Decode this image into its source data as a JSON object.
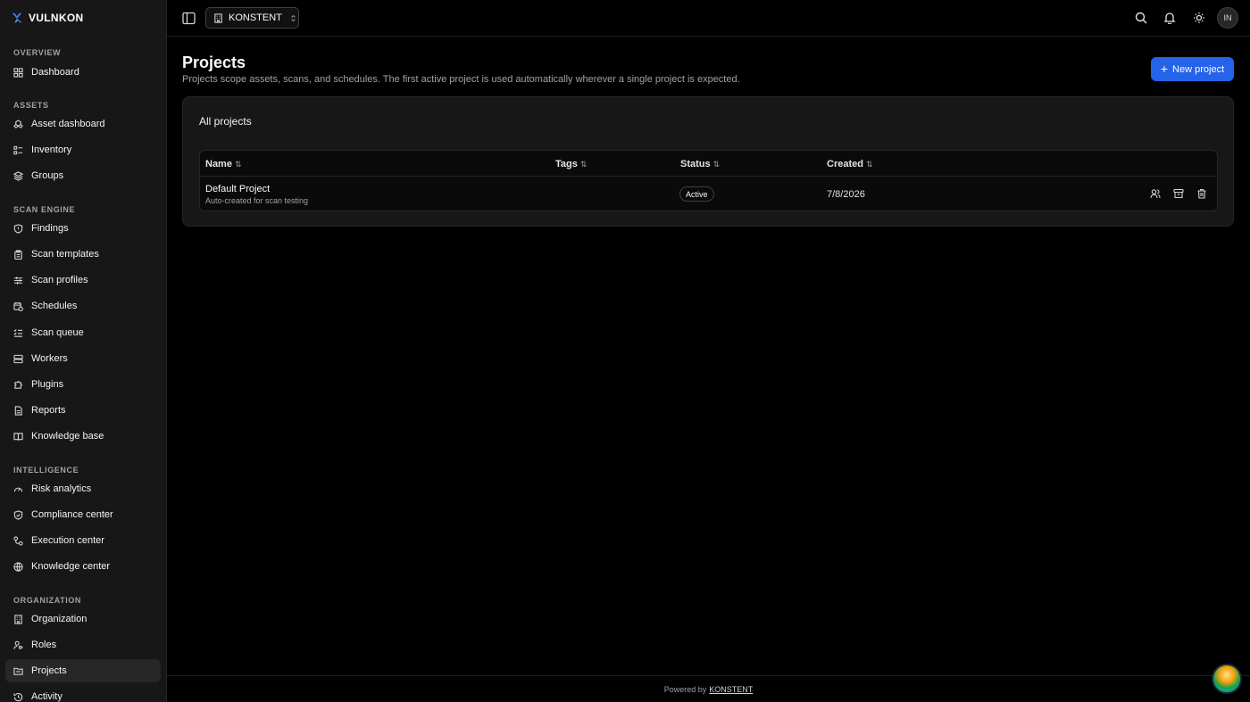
{
  "brand": {
    "name": "VULNKON"
  },
  "sidebar": {
    "sections": [
      {
        "label": "OVERVIEW",
        "items": [
          {
            "label": "Dashboard",
            "icon": "grid-icon"
          }
        ]
      },
      {
        "label": "ASSETS",
        "items": [
          {
            "label": "Asset dashboard",
            "icon": "boxes-icon"
          },
          {
            "label": "Inventory",
            "icon": "list-icon"
          },
          {
            "label": "Groups",
            "icon": "layers-icon"
          }
        ]
      },
      {
        "label": "SCAN ENGINE",
        "items": [
          {
            "label": "Findings",
            "icon": "shield-alert-icon"
          },
          {
            "label": "Scan templates",
            "icon": "clipboard-icon"
          },
          {
            "label": "Scan profiles",
            "icon": "sliders-icon"
          },
          {
            "label": "Schedules",
            "icon": "calendar-clock-icon"
          },
          {
            "label": "Scan queue",
            "icon": "list-checks-icon"
          },
          {
            "label": "Workers",
            "icon": "server-icon"
          },
          {
            "label": "Plugins",
            "icon": "puzzle-icon"
          },
          {
            "label": "Reports",
            "icon": "file-text-icon"
          },
          {
            "label": "Knowledge base",
            "icon": "book-open-icon"
          }
        ]
      },
      {
        "label": "INTELLIGENCE",
        "items": [
          {
            "label": "Risk analytics",
            "icon": "gauge-icon"
          },
          {
            "label": "Compliance center",
            "icon": "shield-check-icon"
          },
          {
            "label": "Execution center",
            "icon": "workflow-icon"
          },
          {
            "label": "Knowledge center",
            "icon": "globe-icon"
          }
        ]
      },
      {
        "label": "ORGANIZATION",
        "items": [
          {
            "label": "Organization",
            "icon": "building-icon"
          },
          {
            "label": "Roles",
            "icon": "user-key-icon"
          },
          {
            "label": "Projects",
            "icon": "folder-icon",
            "active": true
          },
          {
            "label": "Activity",
            "icon": "history-icon"
          }
        ]
      }
    ]
  },
  "topbar": {
    "org": "KONSTENT",
    "avatar_initials": "IN"
  },
  "page": {
    "title": "Projects",
    "description": "Projects scope assets, scans, and schedules. The first active project is used automatically wherever a single project is expected.",
    "new_button": "New project"
  },
  "card": {
    "title": "All projects",
    "columns": [
      "Name",
      "Tags",
      "Status",
      "Created"
    ],
    "rows": [
      {
        "name": "Default Project",
        "subtitle": "Auto-created for scan testing",
        "tags": "",
        "status": "Active",
        "created": "7/8/2026"
      }
    ]
  },
  "footer": {
    "prefix": "Powered by",
    "link": "KONSTENT"
  },
  "colors": {
    "accent": "#2563eb",
    "background": "#000000",
    "sidebar": "#171717"
  }
}
